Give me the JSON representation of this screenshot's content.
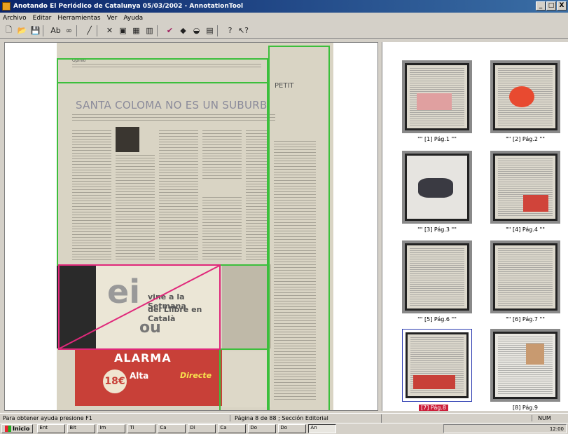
{
  "window": {
    "title": "Anotando El Periódico de Catalunya 05/03/2002 - AnnotationTool",
    "controls": [
      "_",
      "□",
      "X"
    ]
  },
  "menu": [
    "Archivo",
    "Editar",
    "Herramientas",
    "Ver",
    "Ayuda"
  ],
  "toolbar_icons": [
    "new-icon",
    "open-icon",
    "save-icon",
    "text-icon",
    "glasses-icon",
    "pen-icon",
    "cut-icon",
    "page-icon",
    "grid-icon",
    "columns-icon",
    "check-icon",
    "shape-icon",
    "brush-icon",
    "image-icon",
    "help-icon",
    "context-help-icon"
  ],
  "document": {
    "section_label": "Opinió",
    "headline": "SANTA COLOMA NO ES UN SUBURBI",
    "side_title": "PETIT",
    "ad_text": {
      "ei": "ei",
      "line1": "vine a la Setmana",
      "line2": "del Llibre en Català",
      "ou": "ou"
    },
    "bottom_ad": {
      "title": "ALARMA",
      "price": "18€",
      "subtitle": "Alta",
      "tag": "Directe"
    }
  },
  "thumbnails": [
    {
      "label": "\"\" [1] Pág.1 \"\"",
      "selected": false
    },
    {
      "label": "\"\" [2] Pág.2 \"\"",
      "selected": false
    },
    {
      "label": "\"\" [3] Pág.3 \"\"",
      "selected": false
    },
    {
      "label": "\"\" [4] Pág.4 \"\"",
      "selected": false
    },
    {
      "label": "\"\" [5] Pág.6 \"\"",
      "selected": false
    },
    {
      "label": "\"\" [6] Pág.7 \"\"",
      "selected": false
    },
    {
      "label": "[7] Pág.8",
      "selected": true
    },
    {
      "label": "[8] Pág.9",
      "selected": false
    }
  ],
  "status": {
    "help": "Para obtener ayuda presione F1",
    "page_info": "Página 8 de 88 ; Sección Editorial",
    "mode": "NUM"
  },
  "taskbar": {
    "start": "Inicio",
    "tasks": [
      "Ent",
      "Bit",
      "Im",
      "Ti",
      "Ca",
      "Di",
      "Ca",
      "Do",
      "Do",
      "An"
    ],
    "tray": "12:00"
  }
}
